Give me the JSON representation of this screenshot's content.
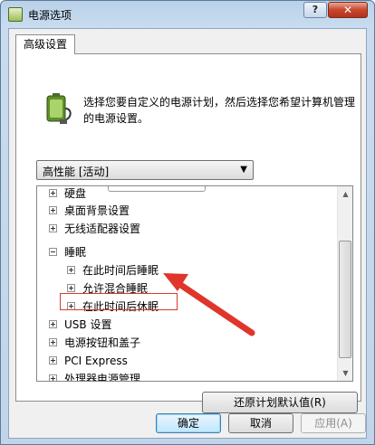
{
  "window": {
    "title": "电源选项",
    "help_label": "?",
    "close_label": "✕"
  },
  "tab": {
    "label": "高级设置"
  },
  "description": "选择您要自定义的电源计划，然后选择您希望计算机管理的电源设置。",
  "plan_select": {
    "value": "高性能 [活动]",
    "arrow": "▼"
  },
  "tree": {
    "items": [
      {
        "label": "硬盘",
        "expander": "plus",
        "level": 0
      },
      {
        "label": "桌面背景设置",
        "expander": "plus",
        "level": 0
      },
      {
        "label": "无线适配器设置",
        "expander": "plus",
        "level": 0
      },
      {
        "label": "睡眠",
        "expander": "minus",
        "level": 0
      },
      {
        "label": "在此时间后睡眠",
        "expander": "plus",
        "level": 1
      },
      {
        "label": "允许混合睡眠",
        "expander": "plus",
        "level": 1
      },
      {
        "label": "在此时间后休眠",
        "expander": "plus",
        "level": 1
      },
      {
        "label": "USB 设置",
        "expander": "plus",
        "level": 0
      },
      {
        "label": "电源按钮和盖子",
        "expander": "plus",
        "level": 0
      },
      {
        "label": "PCI Express",
        "expander": "plus",
        "level": 0
      },
      {
        "label": "处理器电源管理",
        "expander": "plus",
        "level": 0
      }
    ],
    "scroll_up": "▲",
    "scroll_down": "▼"
  },
  "buttons": {
    "restore": "还原计划默认值(R)",
    "ok": "确定",
    "cancel": "取消",
    "apply": "应用(A)"
  },
  "colors": {
    "annotation": "#e0352b",
    "titlebar": "#b9d1ea"
  }
}
